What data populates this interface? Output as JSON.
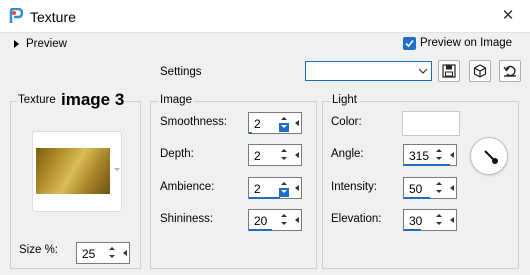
{
  "window": {
    "title": "Texture",
    "close_glyph": "✕",
    "app_icon": "paintshop-pro-icon"
  },
  "preview": {
    "toggle_label": "Preview",
    "checkbox_label": "Preview on Image",
    "checkbox_checked": true
  },
  "settings": {
    "label": "Settings",
    "value": ""
  },
  "texture_group": {
    "title": "Texture",
    "name": "image 3",
    "size_label": "Size %:",
    "size_value": "25"
  },
  "image_group": {
    "title": "Image",
    "fields": [
      {
        "label": "Smoothness:",
        "value": "2",
        "fill": 0.05
      },
      {
        "label": "Depth:",
        "value": "2",
        "fill": 0.0
      },
      {
        "label": "Ambience:",
        "value": "2",
        "fill": 0.6
      },
      {
        "label": "Shininess:",
        "value": "20",
        "fill": 0.45
      }
    ]
  },
  "light_group": {
    "title": "Light",
    "color_label": "Color:",
    "color_value": "#ffffff",
    "angle_label": "Angle:",
    "angle_value": "315",
    "angle_fill": 0.88,
    "intensity_label": "Intensity:",
    "intensity_value": "50",
    "intensity_fill": 0.5,
    "elevation_label": "Elevation:",
    "elevation_value": "30",
    "elevation_fill": 0.33
  },
  "colors": {
    "accent": "#1e6ec8",
    "texture_gold": "#c8a53c"
  }
}
